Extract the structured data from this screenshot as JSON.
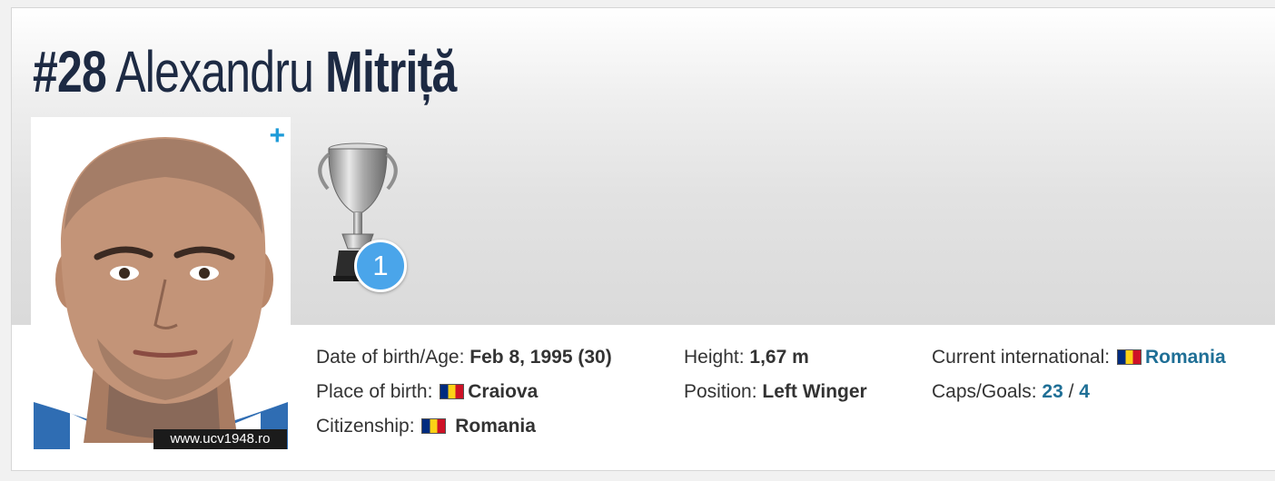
{
  "player": {
    "number": "#28",
    "first_name": "Alexandru",
    "last_name": "Mitriță"
  },
  "photo": {
    "credit": "www.ucv1948.ro",
    "expand_icon": "plus-icon"
  },
  "trophies": {
    "icon": "cup-trophy-icon",
    "count": "1"
  },
  "details": {
    "dob_label": "Date of birth/Age:",
    "dob_value": "Feb 8, 1995 (30)",
    "pob_label": "Place of birth:",
    "pob_value": "Craiova",
    "citizenship_label": "Citizenship:",
    "citizenship_value": "Romania",
    "height_label": "Height:",
    "height_value": "1,67 m",
    "position_label": "Position:",
    "position_value": "Left Winger",
    "international_label": "Current international:",
    "international_value": "Romania",
    "caps_label": "Caps/Goals:",
    "caps_value": "23",
    "caps_separator": "/",
    "goals_value": "4"
  },
  "colors": {
    "title": "#1d2a43",
    "link": "#1f6f96",
    "badge": "#4aa5ea",
    "plus": "#1d9bd8"
  }
}
